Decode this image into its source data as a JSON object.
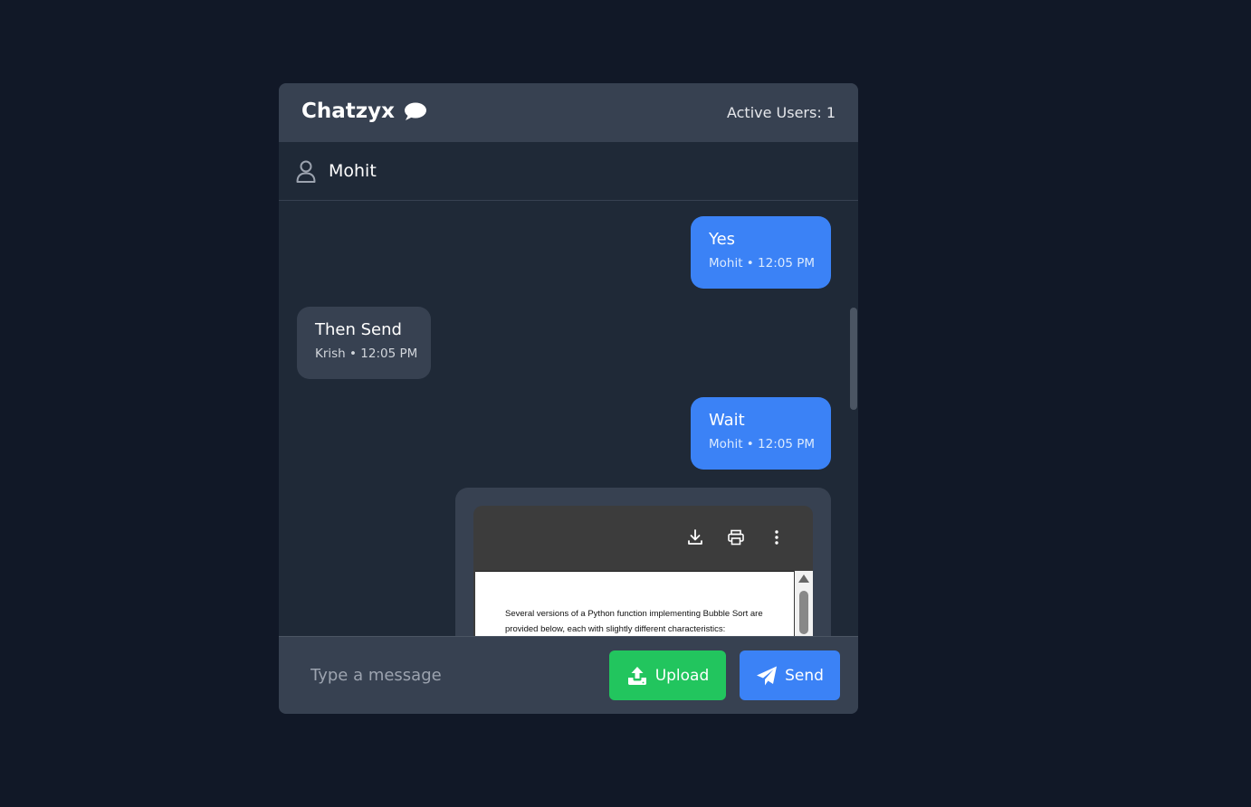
{
  "header": {
    "app_title": "Chatzyx",
    "active_users": "Active Users: 1"
  },
  "current_user": {
    "name": "Mohit"
  },
  "messages": [
    {
      "text": "Yes",
      "meta": "Mohit • 12:05 PM",
      "mine": true
    },
    {
      "text": "Then Send",
      "meta": "Krish • 12:05 PM",
      "mine": false
    },
    {
      "text": "Wait",
      "meta": "Mohit • 12:05 PM",
      "mine": true
    }
  ],
  "file_message": {
    "pdf_text": "Several versions of a Python function implementing Bubble Sort are provided below, each with slightly different characteristics:",
    "toolbar_icons": [
      "download-icon",
      "print-icon",
      "more-vert-icon"
    ]
  },
  "composer": {
    "placeholder": "Type a message",
    "upload_label": "Upload",
    "send_label": "Send"
  },
  "colors": {
    "background": "#111827",
    "panel": "#1f2937",
    "header": "#374151",
    "own_bubble": "#3b82f6",
    "other_bubble": "#374151",
    "upload_button": "#22c55e",
    "send_button": "#3b82f6"
  }
}
